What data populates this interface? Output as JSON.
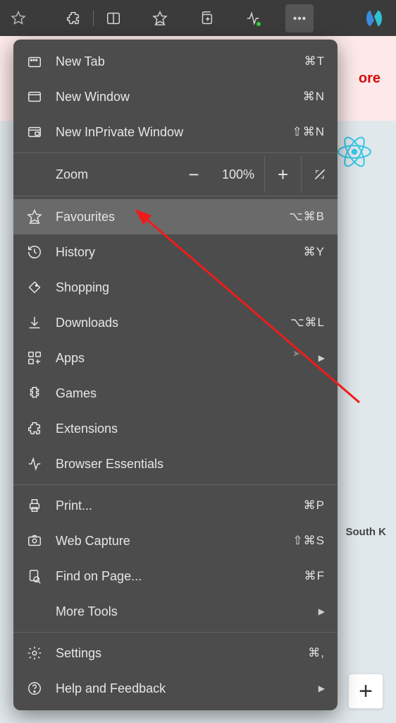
{
  "toolbar": {
    "buttons": [
      "star-icon",
      "extensions-icon",
      "split-screen-icon",
      "favourites-icon",
      "collections-icon",
      "performance-icon",
      "more-icon"
    ],
    "copilot": "copilot-icon"
  },
  "background": {
    "banner_text": "ore",
    "map_label": "South K"
  },
  "menu": {
    "items": [
      {
        "icon": "new-tab-icon",
        "label": "New Tab",
        "shortcut": "⌘T"
      },
      {
        "icon": "new-window-icon",
        "label": "New Window",
        "shortcut": "⌘N"
      },
      {
        "icon": "inprivate-icon",
        "label": "New InPrivate Window",
        "shortcut": "⇧⌘N"
      }
    ],
    "zoom": {
      "label": "Zoom",
      "value": "100%",
      "minus": "−",
      "plus": "+"
    },
    "items2": [
      {
        "icon": "favourites-star-icon",
        "label": "Favourites",
        "shortcut": "⌥⌘B",
        "selected": true
      },
      {
        "icon": "history-icon",
        "label": "History",
        "shortcut": "⌘Y"
      },
      {
        "icon": "shopping-icon",
        "label": "Shopping",
        "shortcut": ""
      },
      {
        "icon": "downloads-icon",
        "label": "Downloads",
        "shortcut": "⌥⌘L"
      },
      {
        "icon": "apps-icon",
        "label": "Apps",
        "shortcut": "",
        "submenu": true
      },
      {
        "icon": "games-icon",
        "label": "Games",
        "shortcut": ""
      },
      {
        "icon": "extensions-menu-icon",
        "label": "Extensions",
        "shortcut": ""
      },
      {
        "icon": "browser-essentials-icon",
        "label": "Browser Essentials",
        "shortcut": ""
      }
    ],
    "items3": [
      {
        "icon": "print-icon",
        "label": "Print...",
        "shortcut": "⌘P"
      },
      {
        "icon": "web-capture-icon",
        "label": "Web Capture",
        "shortcut": "⇧⌘S"
      },
      {
        "icon": "find-icon",
        "label": "Find on Page...",
        "shortcut": "⌘F"
      },
      {
        "icon": "",
        "label": "More Tools",
        "shortcut": "",
        "submenu": true
      }
    ],
    "items4": [
      {
        "icon": "settings-icon",
        "label": "Settings",
        "shortcut": "⌘,"
      },
      {
        "icon": "help-icon",
        "label": "Help and Feedback",
        "shortcut": "",
        "submenu": true
      }
    ]
  }
}
